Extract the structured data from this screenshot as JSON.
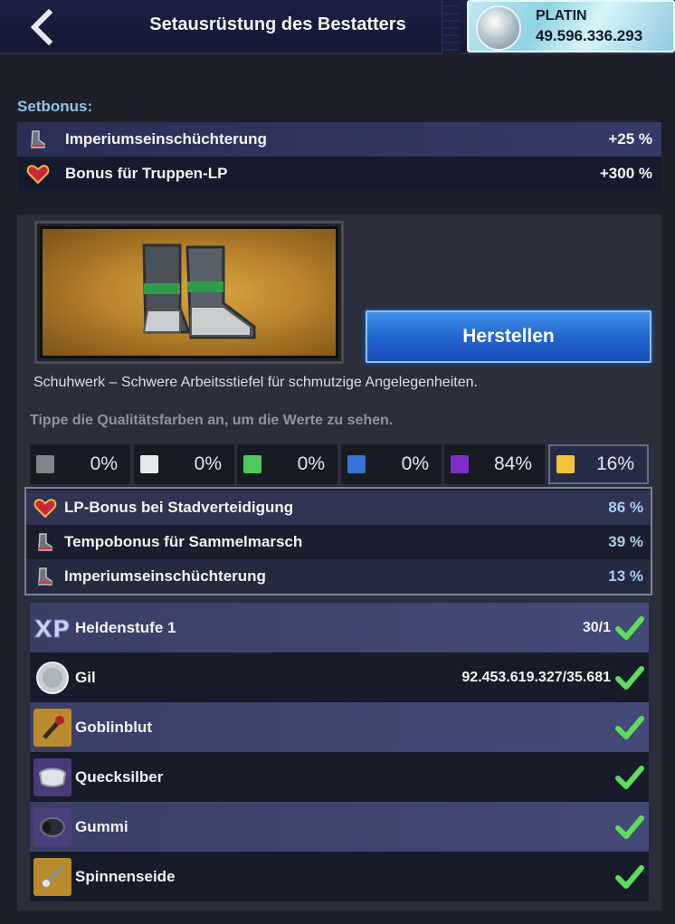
{
  "header": {
    "title": "Setausrüstung des Bestatters",
    "currency_label": "PLATIN",
    "currency_value": "49.596.336.293"
  },
  "setbonus": {
    "heading": "Setbonus:",
    "items": [
      {
        "name": "Imperiumseinschüchterung",
        "value": "+25 %",
        "icon": "boot-icon"
      },
      {
        "name": "Bonus für Truppen-LP",
        "value": "+300 %",
        "icon": "heart-icon"
      }
    ]
  },
  "item": {
    "craft_label": "Herstellen",
    "description": "Schuhwerk – Schwere Arbeitsstiefel für schmutzige Angelegenheiten.",
    "hint": "Tippe die Qualitätsfarben an, um die Werte zu sehen."
  },
  "qualities": [
    {
      "color": "#7f8588",
      "percent": "0%"
    },
    {
      "color": "#e6e8ec",
      "percent": "0%"
    },
    {
      "color": "#4fc957",
      "percent": "0%"
    },
    {
      "color": "#3673d5",
      "percent": "0%"
    },
    {
      "color": "#7a2fc9",
      "percent": "84%"
    },
    {
      "color": "#f3c13a",
      "percent": "16%",
      "selected": true
    }
  ],
  "stats": [
    {
      "name": "LP-Bonus bei Stadverteidigung",
      "value": "86 %",
      "icon": "heart-icon"
    },
    {
      "name": "Tempobonus für Sammelmarsch",
      "value": "39 %",
      "icon": "boot-icon"
    },
    {
      "name": "Imperiumseinschüchterung",
      "value": "13 %",
      "icon": "boot-icon"
    }
  ],
  "requirements": [
    {
      "name": "Heldenstufe 1",
      "value": "30/1",
      "icon": "xp-icon",
      "met": true
    },
    {
      "name": "Gil",
      "value": "92.453.619.327/35.681",
      "icon": "gil-coin-icon",
      "met": true
    },
    {
      "name": "Goblinblut",
      "value": "",
      "icon": "goblin-blood-icon",
      "met": true
    },
    {
      "name": "Quecksilber",
      "value": "",
      "icon": "quicksilver-icon",
      "met": true
    },
    {
      "name": "Gummi",
      "value": "",
      "icon": "rubber-icon",
      "met": true
    },
    {
      "name": "Spinnenseide",
      "value": "",
      "icon": "spider-silk-icon",
      "met": true
    }
  ],
  "colors": {
    "accent_blue": "#2063cf",
    "stat_value": "#a6cff4",
    "heading": "#8fc1ea",
    "check_green": "#5ddc5d"
  }
}
